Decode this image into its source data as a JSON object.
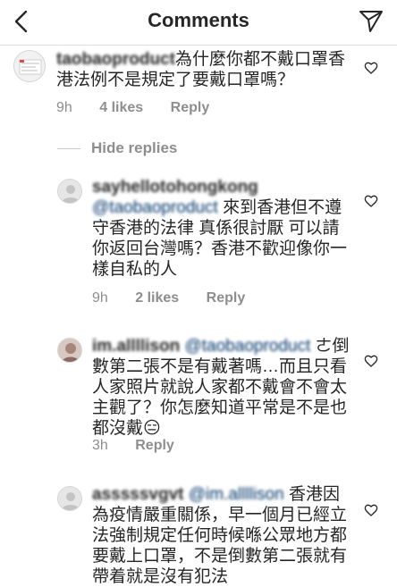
{
  "header": {
    "title": "Comments"
  },
  "comments": [
    {
      "username": "taobaoproduct",
      "text": "為什麼你都不戴口罩香港法例不是規定了要戴口罩嗎？",
      "time": "9h",
      "likes": "4 likes",
      "reply": "Reply"
    }
  ],
  "hide_replies": "Hide replies",
  "replies": [
    {
      "username": "sayhellotohongkong",
      "mention": "@taobaoproduct",
      "text": "來到香港但不遵守香港的法律 真係很討厭 可以請你返回台灣嗎？香港不歡迎像你一樣自私的人",
      "time": "9h",
      "likes": "2 likes",
      "reply": "Reply"
    },
    {
      "username": "im.allllison",
      "mention": "@taobaoproduct",
      "text": "ㄜ倒數第二張不是有戴著嗎…而且只看人家照片就說人家都不戴會不會太主觀了？你怎麼知道平常是不是也都沒戴😑",
      "time": "3h",
      "reply": "Reply"
    },
    {
      "username": "asssssvgvt",
      "mention": "@im.allllison",
      "text": "香港因為疫情嚴重關係，早一個月已經立法強制規定任何時候喺公眾地方都要戴上口罩，不是倒數第二張就有帶着就是沒有犯法"
    }
  ],
  "colors": {
    "text": "#262626",
    "meta": "#8e8e8e",
    "mention": "#003569",
    "divider": "#dbdbdb"
  },
  "icons": [
    "back-chevron-icon",
    "send-paper-plane-icon",
    "heart-outline-icon",
    "default-avatar-icon"
  ]
}
